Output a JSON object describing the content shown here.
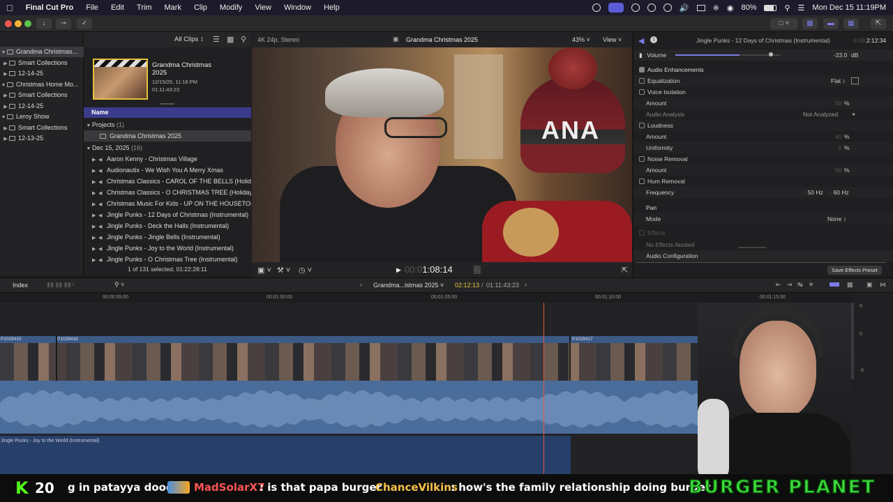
{
  "menubar": {
    "app": "Final Cut Pro",
    "items": [
      "File",
      "Edit",
      "Trim",
      "Mark",
      "Clip",
      "Modify",
      "View",
      "Window",
      "Help"
    ],
    "battery": "80%",
    "datetime": "Mon Dec 15  11:19PM"
  },
  "browser": {
    "filter": "All Clips",
    "libraries": [
      {
        "label": "Grandma Christmas...",
        "level": 0,
        "selected": true
      },
      {
        "label": "Smart Collections",
        "level": 1
      },
      {
        "label": "12-14-25",
        "level": 1
      },
      {
        "label": "Christmas Home Mo...",
        "level": 0
      },
      {
        "label": "Smart Collections",
        "level": 1
      },
      {
        "label": "12-14-25",
        "level": 1
      },
      {
        "label": "Leroy Show",
        "level": 0
      },
      {
        "label": "Smart Collections",
        "level": 1
      },
      {
        "label": "12-13-25",
        "level": 1
      }
    ],
    "project_card": {
      "title": "Grandma Christmas 2025",
      "date": "12/15/25, 11:18 PM",
      "duration": "01:11:43:23"
    },
    "column_name": "Name",
    "projects_label": "Projects",
    "projects_count": "(1)",
    "project_item": "Grandma Christmas 2025",
    "date_group": "Dec 15, 2025",
    "date_count": "(16)",
    "clips": [
      "Aaron Kenny - Christmas Village",
      "Audionautix - We Wish You A Merry Xmas",
      "Christmas Classics - CAROL OF THE BELLS (Holiday",
      "Christmas Classics - O CHRISTMAS TREE (Holiday",
      "Christmas Music For Kids - UP ON THE HOUSETOP",
      "Jingle Punks - 12 Days of Christmas (Instrumental)",
      "Jingle Punks - Deck the Halls (Instrumental)",
      "Jingle Punks - Jingle Bells (Instrumental)",
      "Jingle Punks - Joy to the World (Instrumental)",
      "Jingle Punks - O Christmas Tree (Instrumental)"
    ],
    "status": "1 of 131 selected, 01:22:28:11"
  },
  "viewer": {
    "format": "4K 24p, Stereo",
    "title": "Grandma Christmas 2025",
    "zoom": "43%",
    "view_label": "View",
    "timecode_dim": "00:0",
    "timecode": "1:08:14",
    "hat_text": "ANA"
  },
  "inspector": {
    "clip_title": "Jingle Punks - 12 Days of Christmas (Instrumental)",
    "clip_time": "2:12:34",
    "clip_time_dim": "0:00:",
    "volume_label": "Volume",
    "volume_value": "-23.0",
    "volume_unit": "dB",
    "audio_enhancements": "Audio Enhancements",
    "equalization": "Equalization",
    "eq_value": "Flat",
    "voice_isolation": "Voice Isolation",
    "amount": "Amount",
    "vi_amount": "50",
    "pct": "%",
    "audio_analysis": "Audio Analysis",
    "analysis_value": "Not Analyzed",
    "loudness": "Loudness",
    "loud_amount": "40",
    "uniformity": "Uniformity",
    "uniformity_value": "3",
    "noise_removal": "Noise Removal",
    "noise_amount": "50",
    "hum_removal": "Hum Removal",
    "frequency": "Frequency",
    "freq_50": "50 Hz",
    "freq_60": "60 Hz",
    "pan": "Pan",
    "mode": "Mode",
    "mode_value": "None",
    "effects": "Effects",
    "no_effects": "No Effects Applied",
    "audio_config": "Audio Configuration",
    "save_preset": "Save Effects Preset"
  },
  "timeline": {
    "index": "Index",
    "project": "Grandma...istmas 2025",
    "position": "02:12:13",
    "duration": "01:11:43:23",
    "ruler": [
      "00:00:55:00",
      "00:01:00:00",
      "00:01:05:00",
      "00:01:10:00",
      "00:01:15:00"
    ],
    "clip_labels": [
      "P1029415",
      "P1029416",
      "P1029417"
    ],
    "audio_clip": "Jingle Punks - Joy to the World (Instrumental)",
    "meter_marks": [
      "6",
      "0",
      "-6"
    ]
  },
  "chat": {
    "logo_letter": "K",
    "count": "20",
    "msg0_text": "g in patayya dood",
    "user1": "MadSolarX7",
    "msg1": ": is that papa burger",
    "user2": "ChanceVilkins",
    "msg2": ": how's the family relationship doing burger",
    "brand": "BURGER PLANET"
  },
  "colors": {
    "accent": "#5c5cd6",
    "playhead": "#e2583e",
    "chat_user1": "#ff5555",
    "chat_user2": "#f5c04a",
    "brand": "#3bdc3b"
  }
}
